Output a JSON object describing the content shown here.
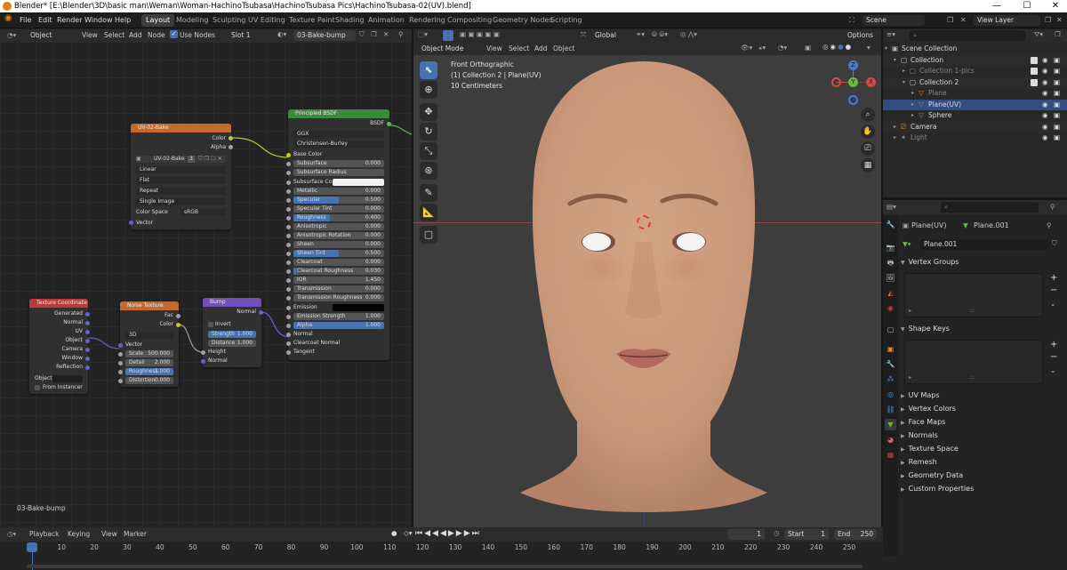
{
  "title_bar": {
    "title": "Blender* [E:\\Blender\\3D\\basic man\\Weman\\Woman-HachinoTsubasa\\HachinoTsubasa Pics\\HachinoTsubasa-02(UV).blend]",
    "minimize": "—",
    "maximize": "☐",
    "close": "✕"
  },
  "menu": [
    "File",
    "Edit",
    "Render",
    "Window",
    "Help"
  ],
  "workspaces": [
    "Layout",
    "Modeling",
    "Sculpting",
    "UV Editing",
    "Texture Paint",
    "Shading",
    "Animation",
    "Rendering",
    "Compositing",
    "Geometry Nodes",
    "Scripting"
  ],
  "active_workspace": "Layout",
  "scene": "Scene",
  "view_layer": "View Layer",
  "node_editor": {
    "object_mode": "Object",
    "menus": [
      "View",
      "Select",
      "Add",
      "Node"
    ],
    "use_nodes": "Use Nodes",
    "slot": "Slot 1",
    "material": "03-Bake-bump",
    "footer_label": "03-Bake-bump",
    "nodes": {
      "image": {
        "title": "UV-02-Bake",
        "out_color": "Color",
        "out_alpha": "Alpha",
        "image_name": "UV-02-Bake",
        "users": "3",
        "interpolation": "Linear",
        "projection": "Flat",
        "extension": "Repeat",
        "source": "Single Image",
        "color_space_label": "Color Space",
        "color_space": "sRGB",
        "in_vector": "Vector"
      },
      "bsdf": {
        "title": "Principled BSDF",
        "out": "BSDF",
        "distribution": "GGX",
        "subsurface_method": "Christensen-Burley",
        "base_color": "Base Color",
        "subsurface_color": "Subsurface Co",
        "emission": "Emission",
        "normal": "Normal",
        "clearcoat_normal": "Clearcoat Normal",
        "tangent": "Tangent",
        "params": [
          {
            "name": "Subsurface",
            "value": "0.000",
            "fill": 0
          },
          {
            "name": "Subsurface Radius",
            "value": "",
            "fill": 0
          },
          {
            "name": "Metallic",
            "value": "0.000",
            "fill": 0
          },
          {
            "name": "Specular",
            "value": "0.500",
            "fill": 0.5
          },
          {
            "name": "Specular Tint",
            "value": "0.000",
            "fill": 0
          },
          {
            "name": "Roughness",
            "value": "0.400",
            "fill": 0.4
          },
          {
            "name": "Anisotropic",
            "value": "0.000",
            "fill": 0
          },
          {
            "name": "Anisotropic Rotation",
            "value": "0.000",
            "fill": 0
          },
          {
            "name": "Sheen",
            "value": "0.000",
            "fill": 0
          },
          {
            "name": "Sheen Tint",
            "value": "0.500",
            "fill": 0.5
          },
          {
            "name": "Clearcoat",
            "value": "0.000",
            "fill": 0
          },
          {
            "name": "Clearcoat Roughness",
            "value": "0.030",
            "fill": 0.03
          },
          {
            "name": "IOR",
            "value": "1.450",
            "fill": 0
          },
          {
            "name": "Transmission",
            "value": "0.000",
            "fill": 0
          },
          {
            "name": "Transmission Roughness",
            "value": "0.000",
            "fill": 0
          }
        ],
        "emission_strength": {
          "name": "Emission Strength",
          "value": "1.000"
        },
        "alpha": {
          "name": "Alpha",
          "value": "1.000"
        }
      },
      "texcoord": {
        "title": "Texture Coordinate",
        "outputs": [
          "Generated",
          "Normal",
          "UV",
          "Object",
          "Camera",
          "Window",
          "Reflection"
        ],
        "object_label": "Object:",
        "from_instancer": "From Instancer"
      },
      "noise": {
        "title": "Noise Texture",
        "out_fac": "Fac",
        "out_color": "Color",
        "dimensions": "3D",
        "in_vector": "Vector",
        "params": [
          {
            "name": "Scale",
            "value": "500.000"
          },
          {
            "name": "Detail",
            "value": "2.000"
          },
          {
            "name": "Roughness",
            "value": "1.000"
          },
          {
            "name": "Distortion",
            "value": "0.000"
          }
        ]
      },
      "bump": {
        "title": "Bump",
        "out_normal": "Normal",
        "invert": "Invert",
        "strength": {
          "name": "Strength",
          "value": "1.000"
        },
        "distance": {
          "name": "Distance",
          "value": "1.000"
        },
        "in_height": "Height",
        "in_normal": "Normal"
      }
    }
  },
  "viewport": {
    "mode": "Object Mode",
    "menus": [
      "View",
      "Select",
      "Add",
      "Object"
    ],
    "orientation": "Global",
    "options": "Options",
    "overlay_title": "Front Orthographic",
    "overlay_collection": "(1) Collection 2 | Plane(UV)",
    "overlay_scale": "10 Centimeters",
    "gizmo": {
      "x": "X",
      "y": "Y",
      "z": "Z"
    }
  },
  "outliner": {
    "rows": [
      {
        "name": "Scene Collection",
        "indent": 0
      },
      {
        "name": "Collection",
        "indent": 1
      },
      {
        "name": "Collection 1-pics",
        "indent": 2
      },
      {
        "name": "Collection 2",
        "indent": 2
      },
      {
        "name": "Plane",
        "indent": 3
      },
      {
        "name": "Plane(UV)",
        "indent": 3
      },
      {
        "name": "Sphere",
        "indent": 3
      },
      {
        "name": "Camera",
        "indent": 1
      },
      {
        "name": "Light",
        "indent": 1
      }
    ]
  },
  "properties": {
    "object": "Plane(UV)",
    "mesh": "Plane.001",
    "data_name": "Plane.001",
    "sections_open": [
      "Vertex Groups",
      "Shape Keys"
    ],
    "sections_closed": [
      "UV Maps",
      "Vertex Colors",
      "Face Maps",
      "Normals",
      "Texture Space",
      "Remesh",
      "Geometry Data",
      "Custom Properties"
    ]
  },
  "timeline": {
    "menus": [
      "Playback",
      "Keying",
      "View",
      "Marker"
    ],
    "current_frame": "1",
    "start_label": "Start",
    "start": "1",
    "end_label": "End",
    "end": "250",
    "ticks": [
      "1",
      "10",
      "20",
      "30",
      "40",
      "50",
      "60",
      "70",
      "80",
      "90",
      "100",
      "110",
      "120",
      "130",
      "140",
      "150",
      "160",
      "170",
      "180",
      "190",
      "200",
      "210",
      "220",
      "230",
      "240",
      "250"
    ]
  }
}
